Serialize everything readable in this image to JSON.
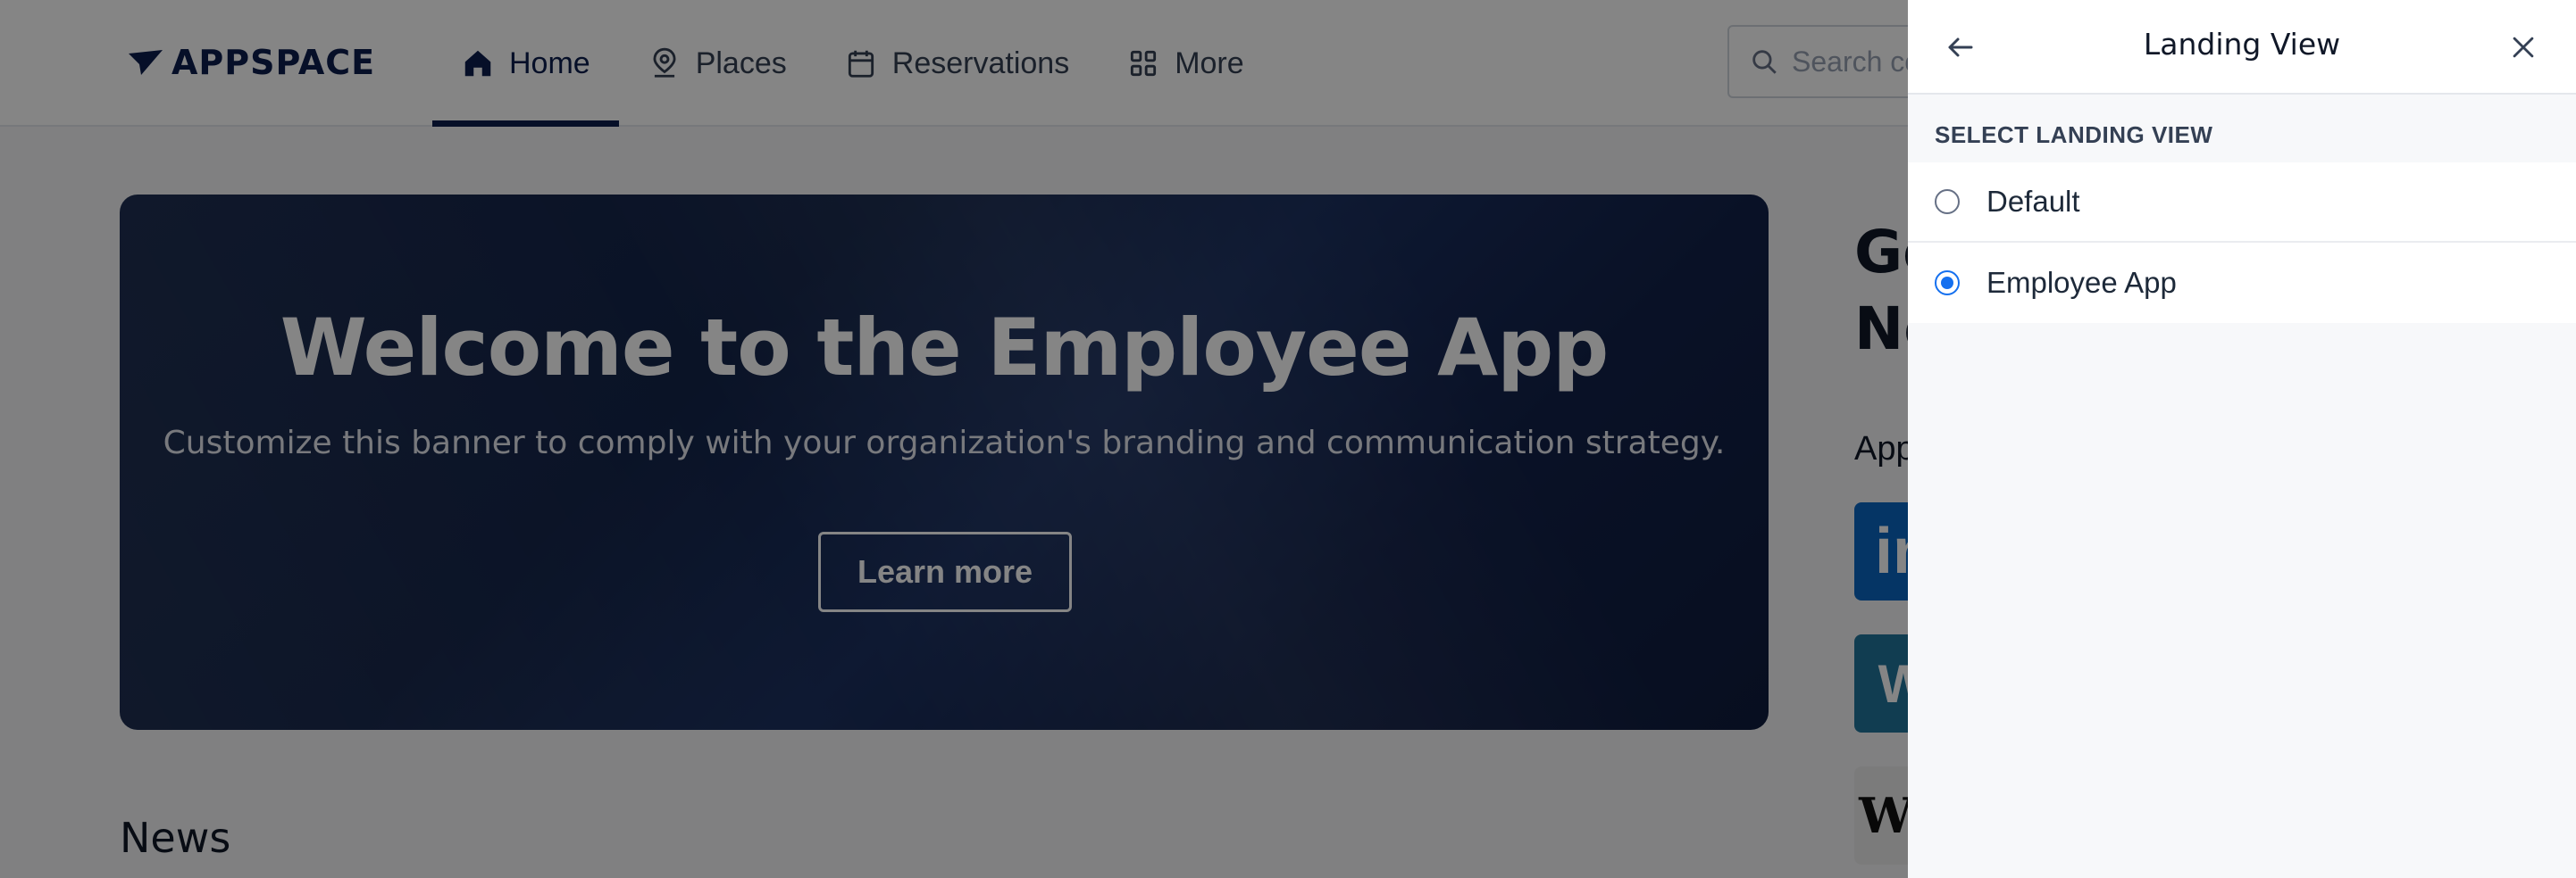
{
  "header": {
    "logo_text": "APPSPACE",
    "nav": [
      {
        "label": "Home",
        "icon": "home-icon",
        "active": true
      },
      {
        "label": "Places",
        "icon": "places-icon",
        "active": false
      },
      {
        "label": "Reservations",
        "icon": "calendar-icon",
        "active": false
      },
      {
        "label": "More",
        "icon": "grid-icon",
        "active": false
      }
    ],
    "search_placeholder": "Search co"
  },
  "banner": {
    "title": "Welcome to the Employee App",
    "subtitle": "Customize this banner to comply with your organization's branding and communication strategy.",
    "button_label": "Learn more"
  },
  "news": {
    "title": "News"
  },
  "right_panel": {
    "greeting_line1": "Go",
    "greeting_line2": "No",
    "apps_label": "App",
    "app_tiles": [
      {
        "name": "linkedin",
        "glyph": "in",
        "color": "#0a66c2"
      },
      {
        "name": "wordpress",
        "glyph": "W",
        "color": "#21759b"
      },
      {
        "name": "wsj",
        "glyph": "WS",
        "color": "#ececec"
      }
    ]
  },
  "drawer": {
    "title": "Landing View",
    "section_label": "SELECT LANDING VIEW",
    "options": [
      {
        "label": "Default",
        "selected": false
      },
      {
        "label": "Employee App",
        "selected": true
      }
    ],
    "accent_color": "#1570ef"
  }
}
